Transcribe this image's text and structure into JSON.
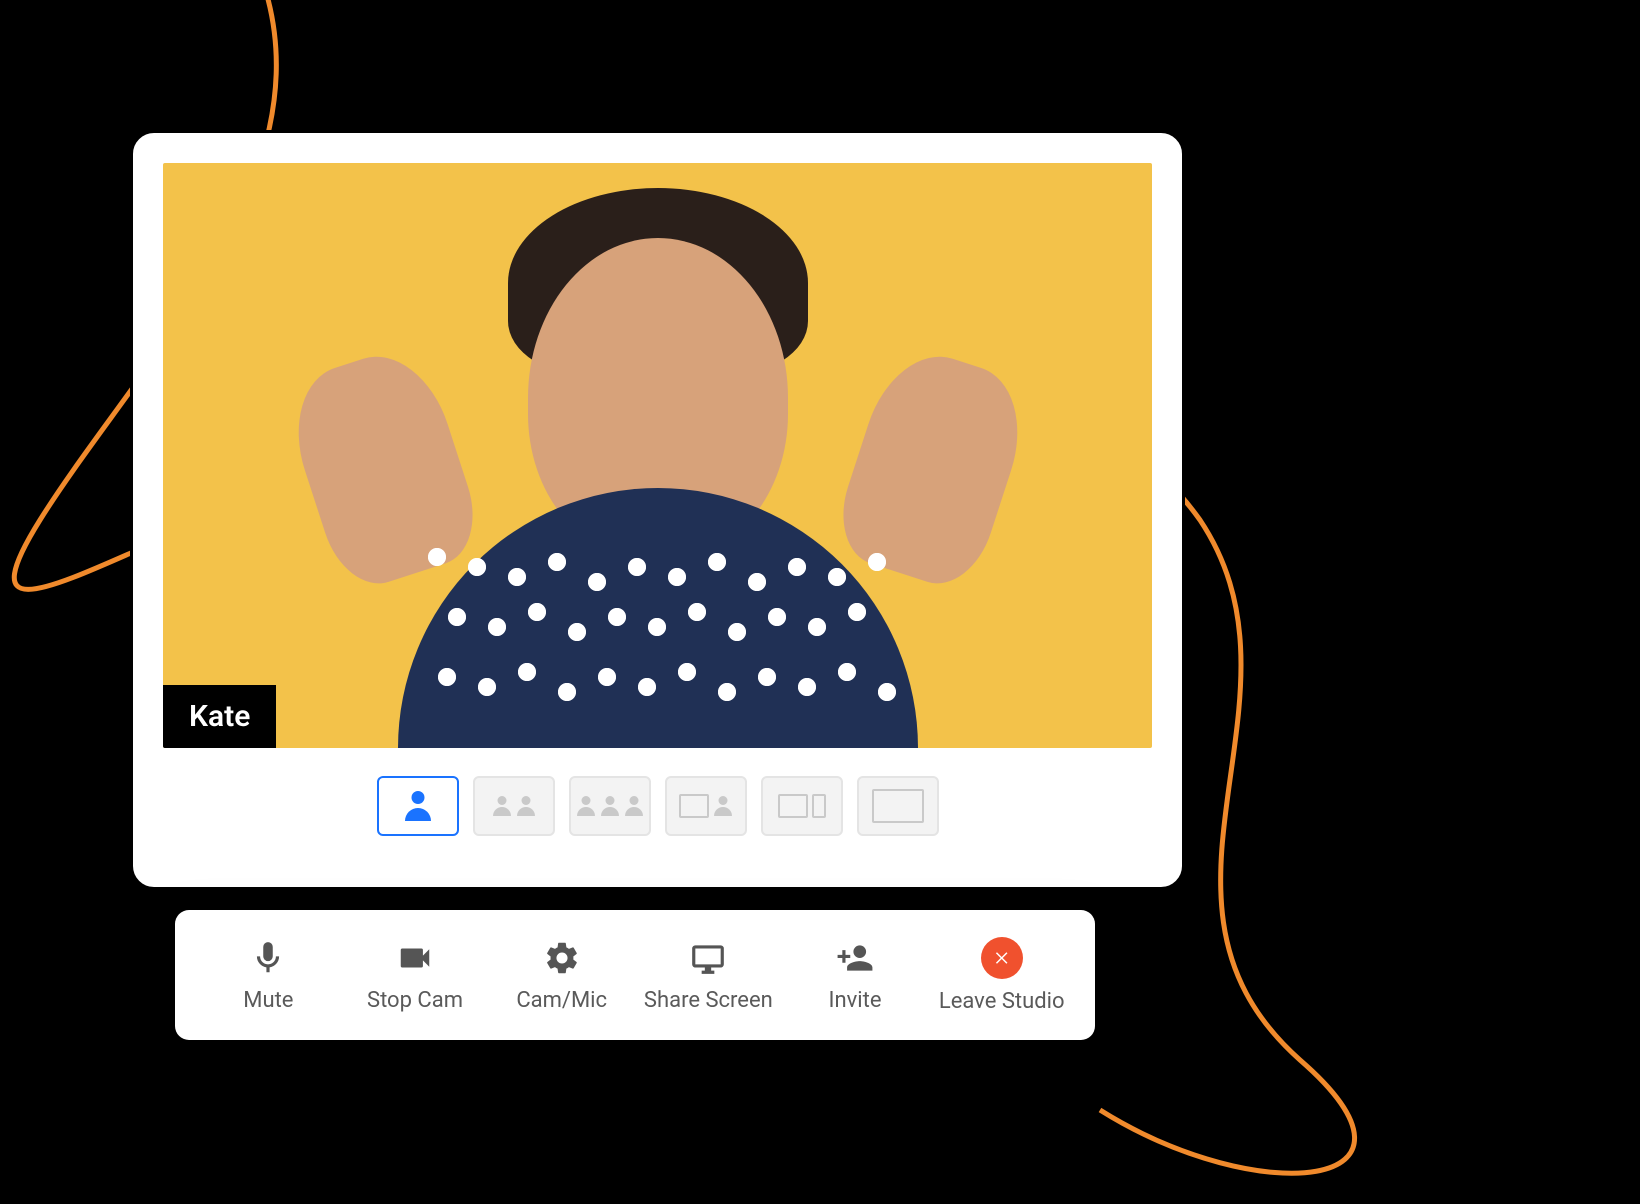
{
  "video": {
    "participant_name": "Kate",
    "background_color": "#f3c24a"
  },
  "layouts": {
    "active_index": 0,
    "options": [
      {
        "id": "solo"
      },
      {
        "id": "two-up"
      },
      {
        "id": "three-up"
      },
      {
        "id": "screen-plus-one"
      },
      {
        "id": "screen-side"
      },
      {
        "id": "screen-only"
      }
    ]
  },
  "toolbar": {
    "mute_label": "Mute",
    "stop_cam_label": "Stop Cam",
    "cam_mic_label": "Cam/Mic",
    "share_screen_label": "Share Screen",
    "invite_label": "Invite",
    "leave_label": "Leave Studio"
  },
  "colors": {
    "accent": "#1a73ff",
    "danger": "#f0512e",
    "swirl": "#f08a2c"
  }
}
